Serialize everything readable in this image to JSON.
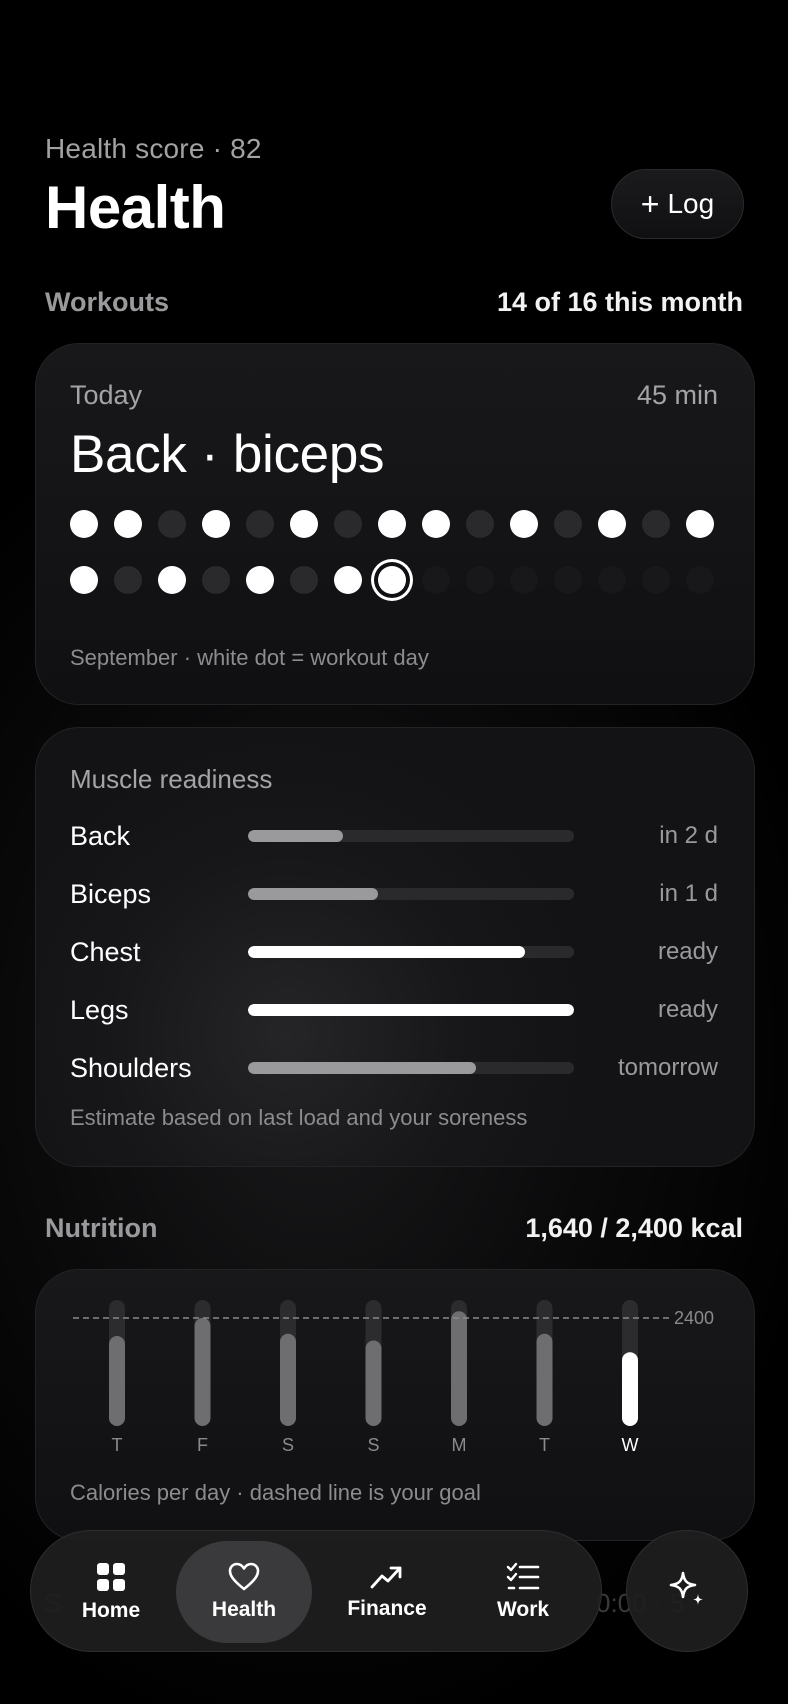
{
  "header": {
    "subtitle": "Health score · 82",
    "title": "Health",
    "log_button": "+ Log",
    "log_plus": "+",
    "log_label": "Log"
  },
  "workouts": {
    "section_title": "Workouts",
    "section_meta": "14 of 16 this month",
    "today_label": "Today",
    "duration": "45 min",
    "workout_name": "Back · biceps",
    "days_row1": [
      "on",
      "off",
      "on",
      "on",
      "off",
      "on",
      "off",
      "on",
      "off",
      "on",
      "on",
      "off",
      "on",
      "off",
      "on",
      "off",
      "on"
    ],
    "days_row1_trimmed": [
      "on",
      "on",
      "off",
      "on",
      "off",
      "on",
      "off",
      "on",
      "on",
      "off",
      "on",
      "off",
      "on",
      "off",
      "on"
    ],
    "days_row2": [
      "on",
      "off",
      "on",
      "off",
      "on",
      "off",
      "on",
      "today",
      "future",
      "future",
      "future",
      "future",
      "future",
      "future",
      "future"
    ],
    "caption": "September · white dot = workout day"
  },
  "muscle": {
    "title": "Muscle readiness",
    "rows": [
      {
        "name": "Back",
        "status": "in 2 d",
        "readiness": 0.29,
        "color": "#9a9a9c"
      },
      {
        "name": "Biceps",
        "status": "in 1 d",
        "readiness": 0.4,
        "color": "#9a9a9c"
      },
      {
        "name": "Chest",
        "status": "ready",
        "readiness": 0.85,
        "color": "#ffffff"
      },
      {
        "name": "Legs",
        "status": "ready",
        "readiness": 1.0,
        "color": "#ffffff"
      },
      {
        "name": "Shoulders",
        "status": "tomorrow",
        "readiness": 0.7,
        "color": "#9a9a9c"
      }
    ],
    "caption": "Estimate based on last load and your soreness"
  },
  "nutrition": {
    "section_title": "Nutrition",
    "section_meta": "1,640 / 2,400 kcal",
    "caption": "Calories per day · dashed line is your goal"
  },
  "chart_data": {
    "type": "bar",
    "categories": [
      "T",
      "F",
      "S",
      "S",
      "M",
      "T",
      "W"
    ],
    "values": [
      2000,
      2400,
      2050,
      1900,
      2550,
      2050,
      1640
    ],
    "goal": 2400,
    "goal_label": "2400",
    "ylim": [
      0,
      2800
    ],
    "highlight_index": 6,
    "colors": {
      "bar": "#6e6e70",
      "track": "#2c2c2e",
      "highlight": "#ffffff",
      "goal": "#8a8a8c"
    }
  },
  "nav": {
    "items": [
      {
        "label": "Home",
        "icon": "grid-icon"
      },
      {
        "label": "Health",
        "icon": "heart-icon"
      },
      {
        "label": "Finance",
        "icon": "trend-up-icon"
      },
      {
        "label": "Work",
        "icon": "checklist-icon"
      }
    ],
    "active": "Health"
  }
}
